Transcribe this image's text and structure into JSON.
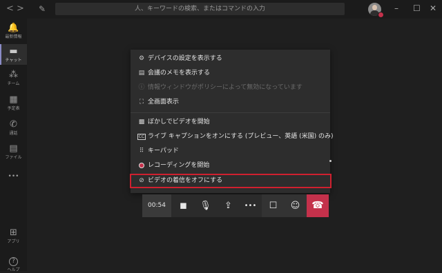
{
  "titlebar": {
    "back": "<",
    "forward": ">",
    "compose_icon": "✎",
    "search_placeholder": "人、キーワードの検索、またはコマンドの入力",
    "minimize": "–",
    "maximize": "☐",
    "close": "✕"
  },
  "rail": {
    "items": [
      {
        "icon": "bell-icon",
        "glyph": "🔔",
        "label": "最新情報"
      },
      {
        "icon": "chat-icon",
        "glyph": "▬",
        "label": "チャット"
      },
      {
        "icon": "teams-icon",
        "glyph": "⁂",
        "label": "チーム"
      },
      {
        "icon": "calendar-icon",
        "glyph": "▦",
        "label": "予定表"
      },
      {
        "icon": "phone-icon",
        "glyph": "✆",
        "label": "通話"
      },
      {
        "icon": "file-icon",
        "glyph": "▤",
        "label": "ファイル"
      },
      {
        "icon": "more-icon",
        "glyph": "•••",
        "label": ""
      }
    ],
    "apps": {
      "glyph": "⊞",
      "label": "アプリ"
    },
    "help": {
      "glyph": "?",
      "label": "ヘルプ"
    },
    "active_index": 1
  },
  "menu": {
    "items": [
      {
        "icon": "gear-icon",
        "glyph": "⚙",
        "label": "デバイスの設定を表示する",
        "enabled": true
      },
      {
        "icon": "notes-icon",
        "glyph": "▤",
        "label": "会議のメモを表示する",
        "enabled": true
      },
      {
        "icon": "info-icon",
        "glyph": "ⓘ",
        "label": "情報ウィンドウがポリシーによって無効になっています",
        "enabled": false
      },
      {
        "icon": "fullscreen-icon",
        "glyph": "⛶",
        "label": "全画面表示",
        "enabled": true
      },
      {
        "icon": "blur-icon",
        "glyph": "▩",
        "label": "ぼかしでビデオを開始",
        "enabled": true
      },
      {
        "icon": "captions-icon",
        "glyph": "CC",
        "label": "ライブ キャプションをオンにする (プレビュー、英語 (米国) のみ)",
        "enabled": true
      },
      {
        "icon": "keypad-icon",
        "glyph": "⠿",
        "label": "キーパッド",
        "enabled": true
      },
      {
        "icon": "record-icon",
        "glyph": "",
        "label": "レコーディングを開始",
        "enabled": true
      },
      {
        "icon": "video-off-icon",
        "glyph": "⊘",
        "label": "ビデオの着信をオフにする",
        "enabled": true
      }
    ]
  },
  "callbar": {
    "timer": "00:54",
    "camera": "◼",
    "mic": "🎙",
    "share": "⇪",
    "more": "•••",
    "chat": "☐",
    "participants": "☺",
    "hangup": "☎"
  },
  "colors": {
    "accent": "#8b8cc7",
    "hangup": "#c4314b",
    "highlight": "#d0202f",
    "background": "#1f1f1f",
    "menu_bg": "#2d2d2d"
  }
}
